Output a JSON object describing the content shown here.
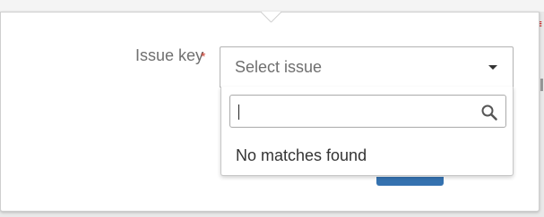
{
  "form": {
    "issue_key_label": "Issue key",
    "required_marker": "*",
    "select_placeholder": "Select issue"
  },
  "dropdown": {
    "search_value": "",
    "empty_message": "No matches found"
  },
  "icons": {
    "search": "search-icon",
    "caret": "chevron-down-icon"
  },
  "colors": {
    "required": "#d04437",
    "primary_button": "#3572b0",
    "label": "#707070"
  }
}
